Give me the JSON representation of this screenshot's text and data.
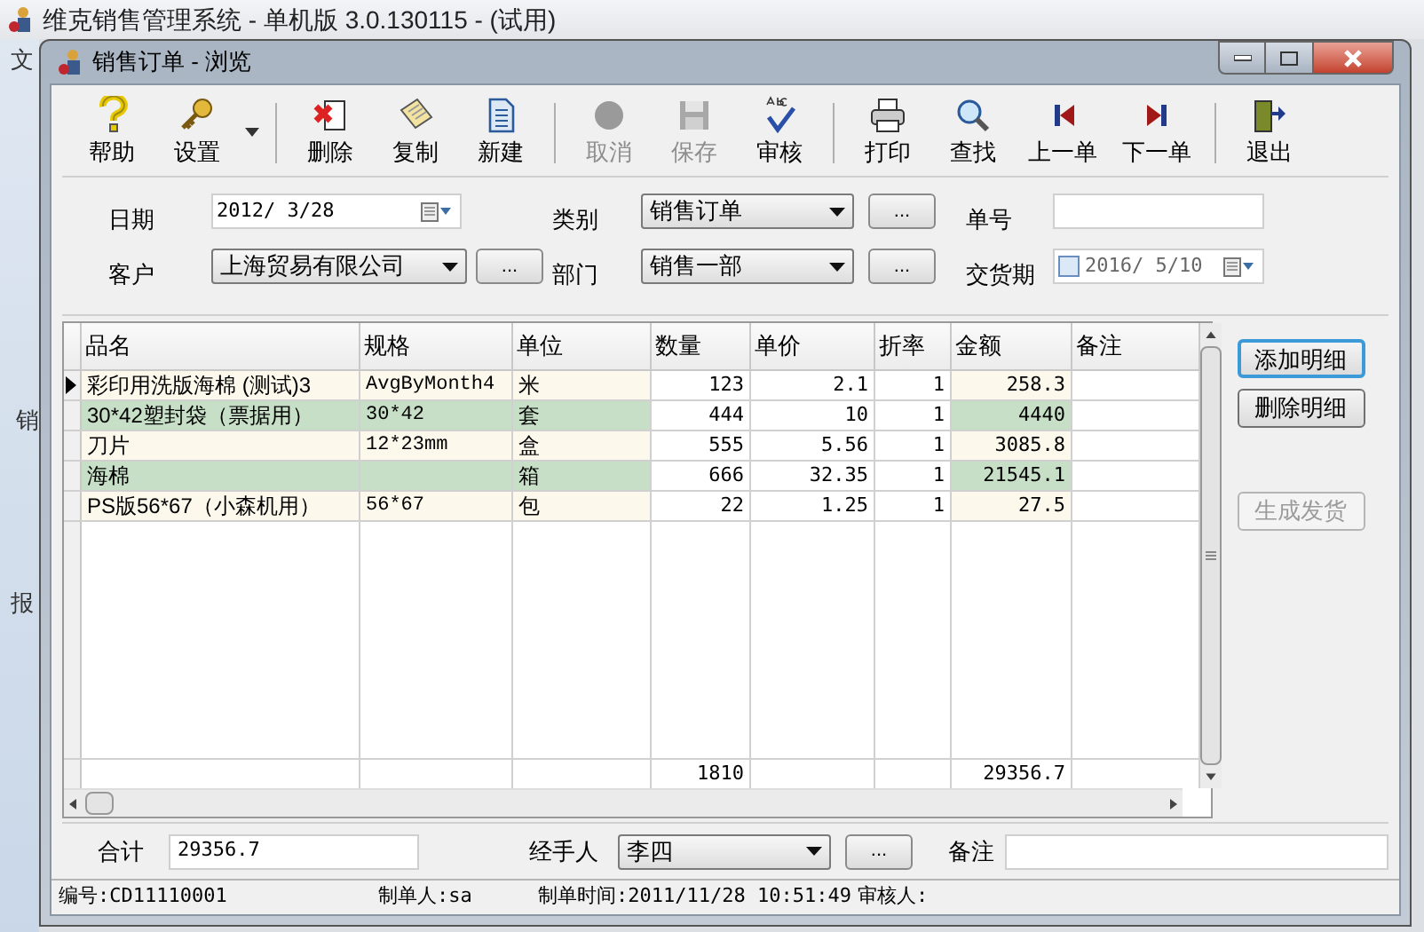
{
  "app": {
    "title": "维克销售管理系统 - 单机版 3.0.130115 - (试用)",
    "menu_fragment": "文",
    "side_fragments": [
      "销",
      "报"
    ]
  },
  "window": {
    "title": "销售订单 - 浏览"
  },
  "toolbar": [
    {
      "label": "帮助",
      "disabled": false
    },
    {
      "label": "设置",
      "disabled": false
    },
    {
      "label": "删除",
      "disabled": false
    },
    {
      "label": "复制",
      "disabled": false
    },
    {
      "label": "新建",
      "disabled": false
    },
    {
      "label": "取消",
      "disabled": true
    },
    {
      "label": "保存",
      "disabled": true
    },
    {
      "label": "审核",
      "disabled": false
    },
    {
      "label": "打印",
      "disabled": false
    },
    {
      "label": "查找",
      "disabled": false
    },
    {
      "label": "上一单",
      "disabled": false
    },
    {
      "label": "下一单",
      "disabled": false
    },
    {
      "label": "退出",
      "disabled": false
    }
  ],
  "header_form": {
    "date": {
      "label": "日期",
      "value": "2012/ 3/28"
    },
    "category": {
      "label": "类别",
      "value": "销售订单"
    },
    "order_no": {
      "label": "单号"
    },
    "customer": {
      "label": "客户",
      "value": "上海贸易有限公司"
    },
    "department": {
      "label": "部门",
      "value": "销售一部"
    },
    "delivery": {
      "label": "交货期",
      "value": "2016/ 5/10",
      "checked": false
    },
    "browse_button": "..."
  },
  "table": {
    "columns": [
      "品名",
      "规格",
      "单位",
      "数量",
      "单价",
      "折率",
      "金额",
      "备注"
    ],
    "rows": [
      {
        "selected": true,
        "cells": [
          "彩印用洗版海棉 (测试)3",
          "AvgByMonth4",
          "米",
          "123",
          "2.1",
          "1",
          "258.3",
          null
        ]
      },
      {
        "selected": false,
        "cells": [
          "30*42塑封袋（票据用）",
          "30*42",
          "套",
          "444",
          "10",
          "1",
          "4440",
          null
        ]
      },
      {
        "selected": false,
        "cells": [
          "刀片",
          "12*23mm",
          "盒",
          "555",
          "5.56",
          "1",
          "3085.8",
          null
        ]
      },
      {
        "selected": false,
        "cells": [
          "海棉",
          null,
          "箱",
          "666",
          "32.35",
          "1",
          "21545.1",
          null
        ]
      },
      {
        "selected": false,
        "cells": [
          "PS版56*67（小森机用）",
          "56*67",
          "包",
          "22",
          "1.25",
          "1",
          "27.5",
          null
        ]
      }
    ],
    "totals": {
      "quantity": "1810",
      "amount": "29356.7"
    }
  },
  "side_buttons": [
    {
      "label": "添加明细",
      "disabled": false,
      "focused": true
    },
    {
      "label": "删除明细",
      "disabled": false,
      "focused": false
    },
    {
      "label": "生成发货",
      "disabled": true,
      "focused": false
    }
  ],
  "footer_form": {
    "total": {
      "label": "合计",
      "value": "29356.7"
    },
    "handler": {
      "label": "经手人",
      "value": "李四"
    },
    "remark": {
      "label": "备注"
    }
  },
  "status_bar": [
    "编号:CD11110001",
    "制单人:sa",
    "制单时间:2011/11/28 10:51:49",
    "审核人:"
  ]
}
